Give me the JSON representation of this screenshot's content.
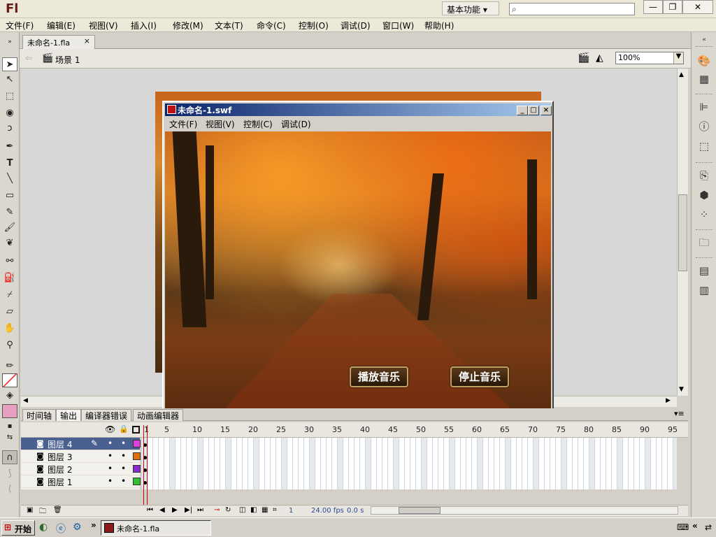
{
  "app": {
    "logo": "Fl",
    "workspace": "基本功能",
    "search_icon": "search-icon"
  },
  "window_buttons": {
    "minimize": "—",
    "restore": "❐",
    "close": "✕"
  },
  "menu": [
    "文件(F)",
    "编辑(E)",
    "视图(V)",
    "插入(I)",
    "修改(M)",
    "文本(T)",
    "命令(C)",
    "控制(O)",
    "调试(D)",
    "窗口(W)",
    "帮助(H)"
  ],
  "document": {
    "tab": "未命名-1.fla",
    "close": "×",
    "scene": "场景 1",
    "zoom": "100%"
  },
  "swf": {
    "title": "未命名-1.swf",
    "menu": [
      "文件(F)",
      "视图(V)",
      "控制(C)",
      "调试(D)"
    ],
    "play_button": "播放音乐",
    "stop_button": "停止音乐"
  },
  "timeline": {
    "tabs": [
      "时间轴",
      "输出",
      "编译器错误",
      "动画编辑器"
    ],
    "frame_numbers": [
      "1",
      "5",
      "10",
      "15",
      "20",
      "25",
      "30",
      "35",
      "40",
      "45",
      "50",
      "55",
      "60",
      "65",
      "70",
      "75",
      "80",
      "85",
      "90",
      "95"
    ],
    "layers": [
      {
        "name": "图层 4",
        "color": "#e040e0",
        "selected": true
      },
      {
        "name": "图层 3",
        "color": "#e07010",
        "selected": false
      },
      {
        "name": "图层 2",
        "color": "#8a2bd0",
        "selected": false
      },
      {
        "name": "图层 1",
        "color": "#30c030",
        "selected": false
      }
    ],
    "current_frame": "1",
    "fps": "24.00 fps",
    "time": "0.0 s"
  },
  "taskbar": {
    "start": "开始",
    "task": "未命名-1.fla",
    "arrows": "»",
    "tray_arrows": "«"
  }
}
